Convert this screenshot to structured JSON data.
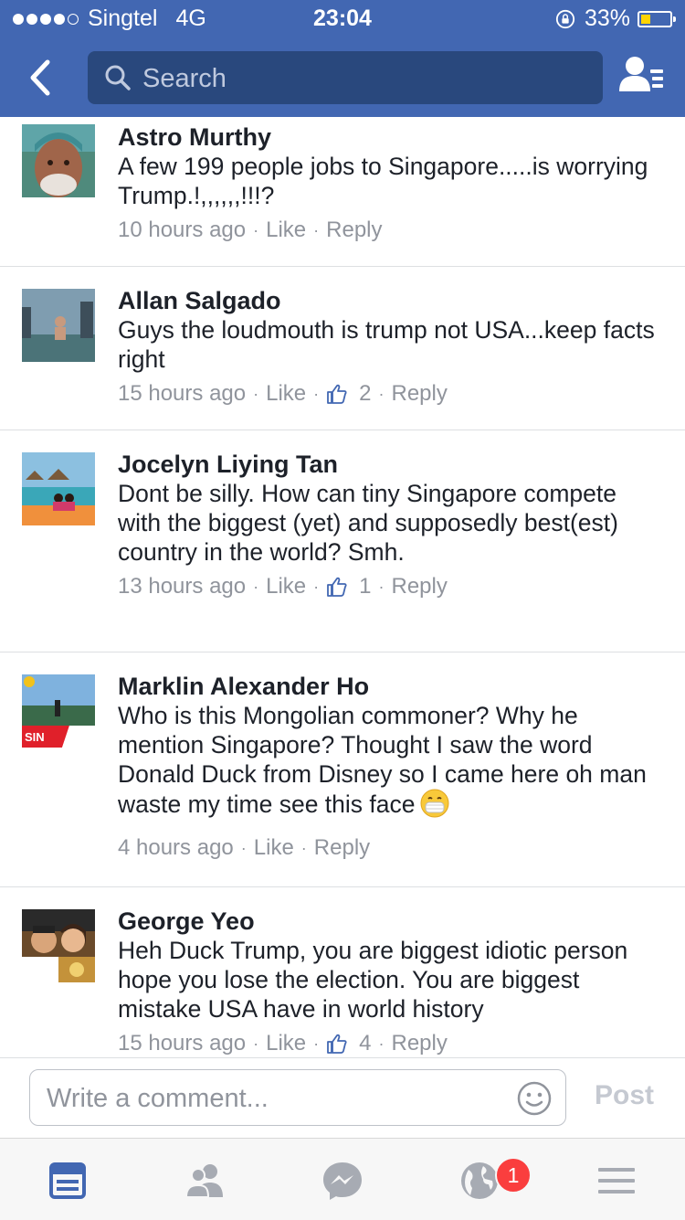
{
  "status_bar": {
    "carrier": "Singtel",
    "network": "4G",
    "time": "23:04",
    "battery": "33%",
    "battery_level": 0.33
  },
  "nav": {
    "search_placeholder": "Search"
  },
  "comments": [
    {
      "author": "Astro Murthy",
      "text": "A few 199 people jobs to Singapore.....is worrying Trump.!,,,,,,!!!?",
      "time": "10 hours ago",
      "like": "Like",
      "reply": "Reply",
      "likes": ""
    },
    {
      "author": "Allan Salgado",
      "text": "Guys the loudmouth is trump not USA...keep facts right",
      "time": "15 hours ago",
      "like": "Like",
      "reply": "Reply",
      "likes": "2"
    },
    {
      "author": "Jocelyn Liying Tan",
      "text": "Dont be silly. How can tiny Singapore compete with the biggest (yet) and supposedly best(est) country in the world? Smh.",
      "time": "13 hours ago",
      "like": "Like",
      "reply": "Reply",
      "likes": "1"
    },
    {
      "author": "Marklin Alexander Ho",
      "text": "Who is this Mongolian commoner? Why he mention Singapore? Thought I saw the word Donald Duck from Disney so I came here oh man waste my time see this face",
      "avatar_tag": "SIN",
      "time": "4 hours ago",
      "like": "Like",
      "reply": "Reply",
      "likes": ""
    },
    {
      "author": "George Yeo",
      "text": "Heh Duck Trump, you are biggest idiotic person hope you lose the election. You are biggest mistake USA have in world history",
      "time": "15 hours ago",
      "like": "Like",
      "reply": "Reply",
      "likes": "4"
    }
  ],
  "composer": {
    "placeholder": "Write a comment...",
    "post_label": "Post"
  },
  "tabbar": {
    "notifications_count": "1"
  },
  "colors": {
    "brand": "#4267b2",
    "search_bg": "#29487d",
    "link_blue": "#4267b2",
    "meta_gray": "#90949c",
    "badge_red": "#fa3e3e"
  }
}
